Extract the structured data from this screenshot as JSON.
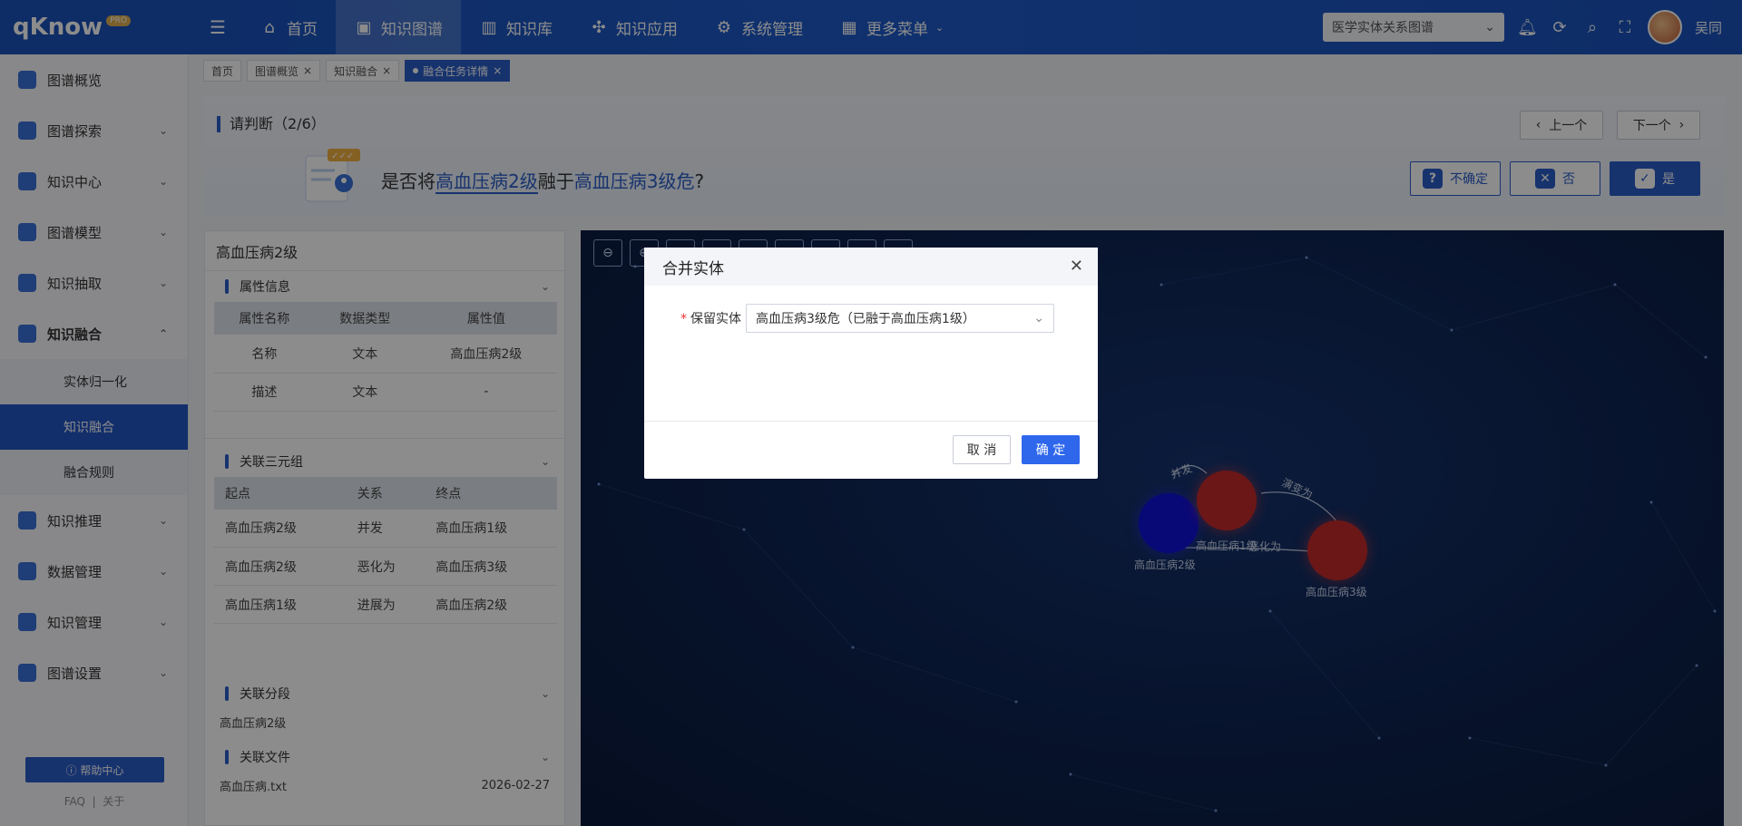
{
  "app": {
    "logo_text": "qKnow",
    "logo_badge": "PRO",
    "username": "吴同",
    "graph_select": "医学实体关系图谱"
  },
  "nav": [
    {
      "label": "首页",
      "icon": "home-icon"
    },
    {
      "label": "知识图谱",
      "icon": "book-icon"
    },
    {
      "label": "知识库",
      "icon": "library-icon"
    },
    {
      "label": "知识应用",
      "icon": "app-icon"
    },
    {
      "label": "系统管理",
      "icon": "gear-icon"
    },
    {
      "label": "更多菜单",
      "icon": "grid-icon"
    }
  ],
  "sidebar": {
    "items": [
      {
        "label": "图谱概览"
      },
      {
        "label": "图谱探索"
      },
      {
        "label": "知识中心"
      },
      {
        "label": "图谱模型"
      },
      {
        "label": "知识抽取"
      },
      {
        "label": "知识融合"
      },
      {
        "label": "知识推理"
      },
      {
        "label": "数据管理"
      },
      {
        "label": "知识管理"
      },
      {
        "label": "图谱设置"
      }
    ],
    "sub_items": [
      {
        "label": "实体归一化"
      },
      {
        "label": "知识融合"
      },
      {
        "label": "融合规则"
      }
    ],
    "help": "帮助中心",
    "faq": "FAQ",
    "about": "关于"
  },
  "tabs": [
    {
      "label": "首页"
    },
    {
      "label": "图谱概览"
    },
    {
      "label": "知识融合"
    },
    {
      "label": "融合任务详情"
    }
  ],
  "question": {
    "title": "请判断（2/6）",
    "prefix": "是否将",
    "source": "高血压病2级",
    "middle": "融于",
    "target": "高血压病3级危",
    "suffix": "?",
    "prev": "上一个",
    "next": "下一个",
    "unsure": "不确定",
    "no": "否",
    "yes": "是"
  },
  "left_panel": {
    "entity": "高血压病2级",
    "attr_section": "属性信息",
    "attr_headers": [
      "属性名称",
      "数据类型",
      "属性值"
    ],
    "attr_rows": [
      [
        "名称",
        "文本",
        "高血压病2级"
      ],
      [
        "描述",
        "文本",
        "-"
      ]
    ],
    "triple_section": "关联三元组",
    "triple_headers": [
      "起点",
      "关系",
      "终点"
    ],
    "triple_rows": [
      [
        "高血压病2级",
        "并发",
        "高血压病1级"
      ],
      [
        "高血压病2级",
        "恶化为",
        "高血压病3级"
      ],
      [
        "高血压病1级",
        "进展为",
        "高血压病2级"
      ]
    ],
    "segment_section": "关联分段",
    "segment_value": "高血压病2级",
    "file_section": "关联文件",
    "file_name": "高血压病.txt",
    "file_date": "2026-02-27"
  },
  "graph": {
    "nodes": [
      {
        "label": "高血压病2级",
        "color": "#1010d8"
      },
      {
        "label": "高血压病1级",
        "color": "#c42a2a"
      },
      {
        "label": "高血压病3级",
        "color": "#c42a2a"
      }
    ],
    "edges": [
      "并发",
      "演变为",
      "恶化为"
    ]
  },
  "modal": {
    "title": "合并实体",
    "field_label": "保留实体",
    "field_value": "高血压病3级危（已融于高血压病1级）",
    "cancel": "取 消",
    "ok": "确 定"
  }
}
